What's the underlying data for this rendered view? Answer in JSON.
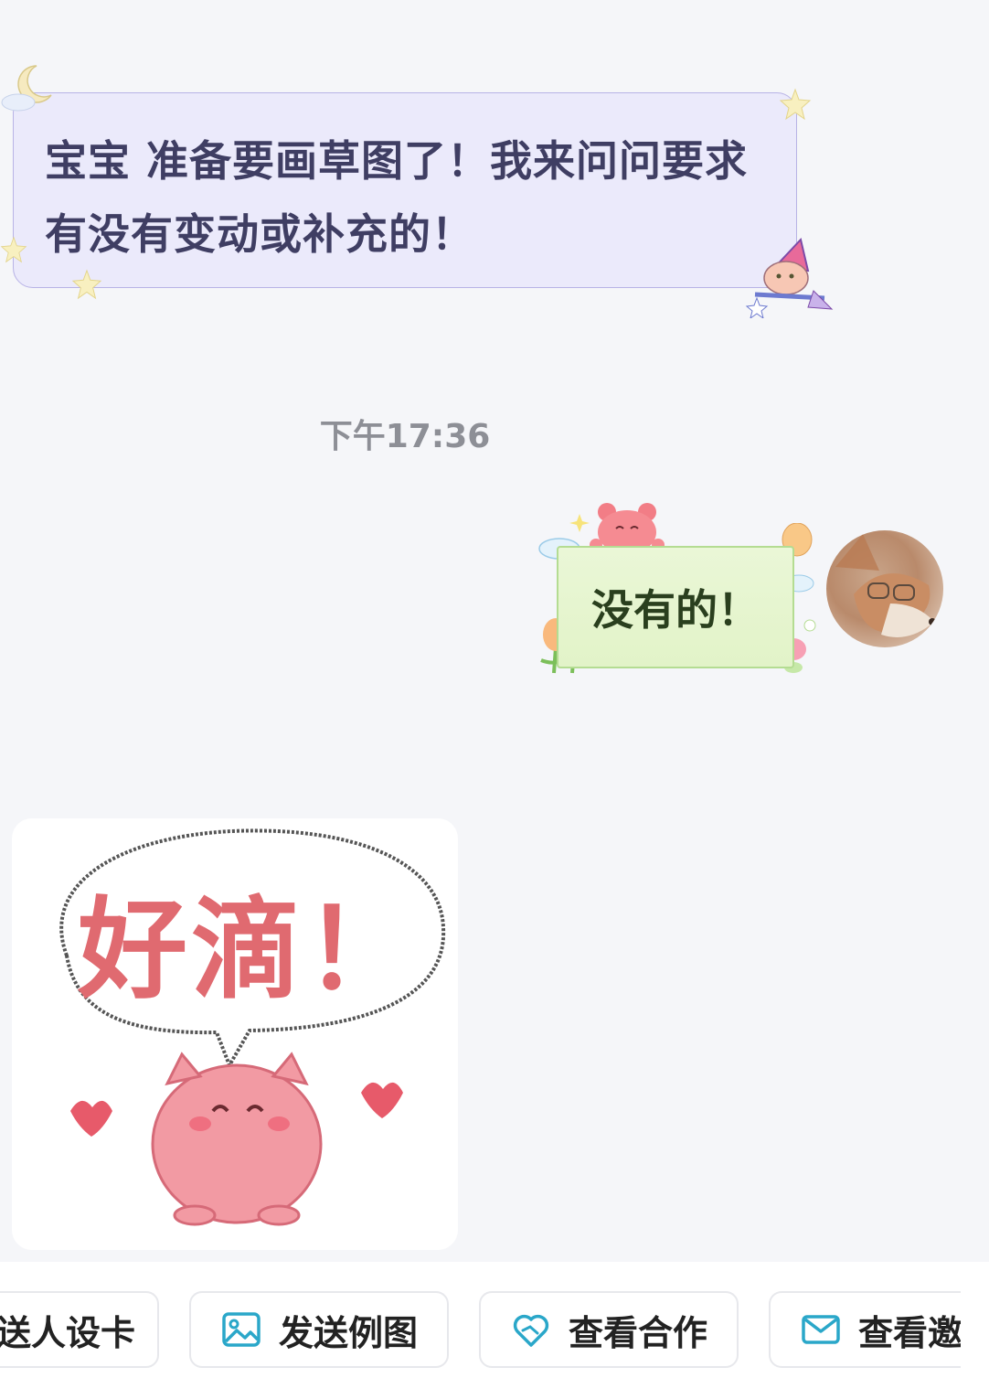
{
  "messages": {
    "incoming_text": "宝宝 准备要画草图了！我来问问要求有没有变动或补充的！",
    "timestamp": "下午17:36",
    "outgoing_text": "没有的！",
    "sticker_text": "好滴！"
  },
  "quick_actions": [
    {
      "label": "送人设卡",
      "icon": "card-icon"
    },
    {
      "label": "发送例图",
      "icon": "image-icon"
    },
    {
      "label": "查看合作",
      "icon": "heart-handshake-icon"
    },
    {
      "label": "查看邀",
      "icon": "mail-icon"
    }
  ],
  "colors": {
    "incoming_bubble": "#ebeafb",
    "outgoing_bubble": "#e2f3c8",
    "accent_icon": "#2aa7c9",
    "background": "#f5f6f9"
  }
}
